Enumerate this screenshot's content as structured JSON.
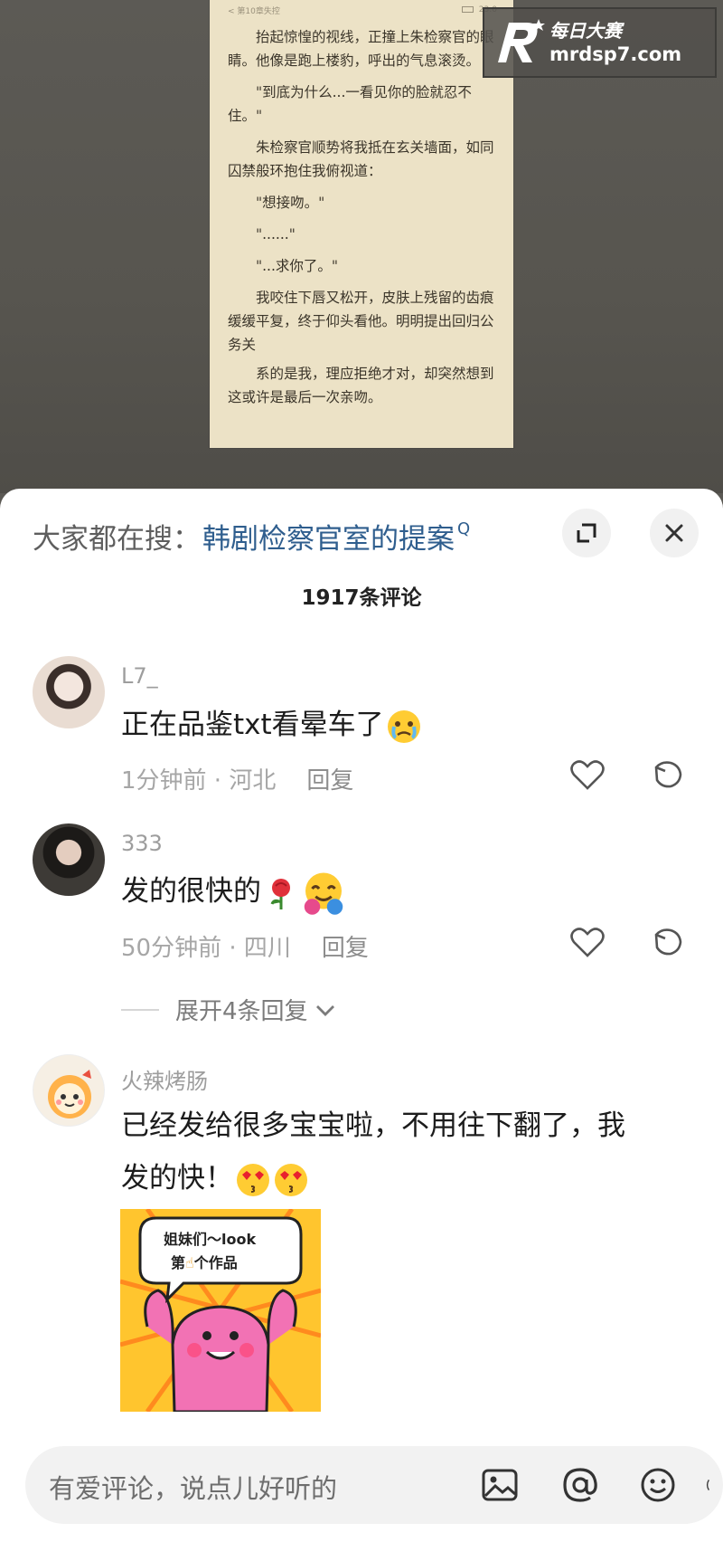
{
  "book": {
    "status_left": "< 第10章失控",
    "status_right": "23:0",
    "paragraphs": [
      "抬起惊惶的视线，正撞上朱检察官的眼睛。他像是跑上楼豹，呼出的气息滚烫。",
      "\"到底为什么...一看见你的脸就忍不住。\"",
      "朱检察官顺势将我抵在玄关墙面，如同囚禁般环抱住我俯视道：",
      "\"想接吻。\"",
      "\"......\"",
      "\"...求你了。\"",
      "我咬住下唇又松开，皮肤上残留的齿痕缓缓平复，终于仰头看他。明明提出回归公务关",
      "系的是我，理应拒绝才对，却突然想到这或许是最后一次亲吻。"
    ]
  },
  "watermark": {
    "cn": "每日大赛",
    "url": "mrdsp7.com"
  },
  "search": {
    "prefix": "大家都在搜：",
    "term": "韩剧检察官室的提案",
    "q_glyph": "Q"
  },
  "comment_count": "1917条评论",
  "comments": [
    {
      "name": "L7_",
      "text": "正在品鉴txt看晕车了",
      "time": "1分钟前 · 河北",
      "reply": "回复"
    },
    {
      "name": "333",
      "text": "发的很快的",
      "time": "50分钟前 · 四川",
      "reply": "回复"
    },
    {
      "name": "火辣烤肠",
      "text_line1": "已经发给很多宝宝啦，不用往下翻了，我",
      "text_line2": "发的快！"
    }
  ],
  "expand_replies": "展开4条回复",
  "sticker": {
    "line1": "姐妹们～look",
    "line2": "第",
    "line3": "个作品"
  },
  "input": {
    "placeholder": "有爱评论，说点儿好听的"
  },
  "colors": {
    "link_blue": "#2f5e8e",
    "sheet_bg": "#ffffff",
    "book_bg": "#ece2c6"
  }
}
